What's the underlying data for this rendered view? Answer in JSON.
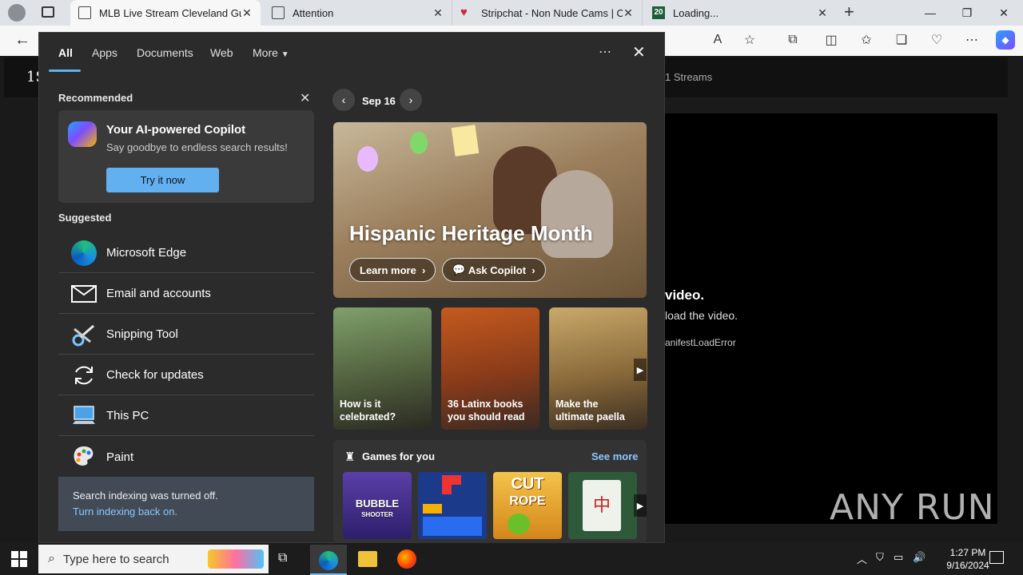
{
  "browser": {
    "tabs": [
      {
        "label": "MLB Live Stream Cleveland Guar"
      },
      {
        "label": "Attention"
      },
      {
        "label": "Stripchat - Non Nude Cams | Ch"
      },
      {
        "label": "Loading..."
      }
    ],
    "tab4_favicon_text": "20"
  },
  "site": {
    "logo_text": "1S",
    "nav_streams": "1 Streams",
    "error_title": "video.",
    "error_line": "load the video.",
    "error_code": "anifestLoadError"
  },
  "search_panel": {
    "tabs": [
      "All",
      "Apps",
      "Documents",
      "Web",
      "More"
    ],
    "recommended_title": "Recommended",
    "copilot": {
      "title": "Your AI-powered Copilot",
      "subtitle": "Say goodbye to endless search results!",
      "button": "Try it now"
    },
    "suggested_title": "Suggested",
    "suggested": [
      {
        "label": "Microsoft Edge",
        "icon": "edge-icon"
      },
      {
        "label": "Email and accounts",
        "icon": "mail-icon"
      },
      {
        "label": "Snipping Tool",
        "icon": "snipping-icon"
      },
      {
        "label": "Check for updates",
        "icon": "refresh-icon"
      },
      {
        "label": "This PC",
        "icon": "computer-icon"
      },
      {
        "label": "Paint",
        "icon": "palette-icon"
      }
    ],
    "indexing": {
      "text": "Search indexing was turned off.",
      "link": "Turn indexing back on."
    },
    "date": "Sep 16",
    "hero": {
      "title": "Hispanic Heritage Month",
      "learn_more": "Learn more",
      "ask_copilot": "Ask Copilot"
    },
    "tiles": [
      {
        "line1": "How is it",
        "line2": "celebrated?"
      },
      {
        "line1": "36 Latinx books",
        "line2": "you should read"
      },
      {
        "line1": "Make the",
        "line2": "ultimate paella"
      }
    ],
    "games_title": "Games for you",
    "see_more": "See more",
    "games": [
      {
        "name": "BUBBLE",
        "sub": "SHOOTER"
      },
      {
        "name": "",
        "sub": ""
      },
      {
        "name": "CUT",
        "sub": "ROPE"
      },
      {
        "name": "",
        "sub": ""
      }
    ]
  },
  "taskbar": {
    "search_placeholder": "Type here to search",
    "time": "1:27 PM",
    "date": "9/16/2024",
    "watermark": "ANY RUN"
  }
}
